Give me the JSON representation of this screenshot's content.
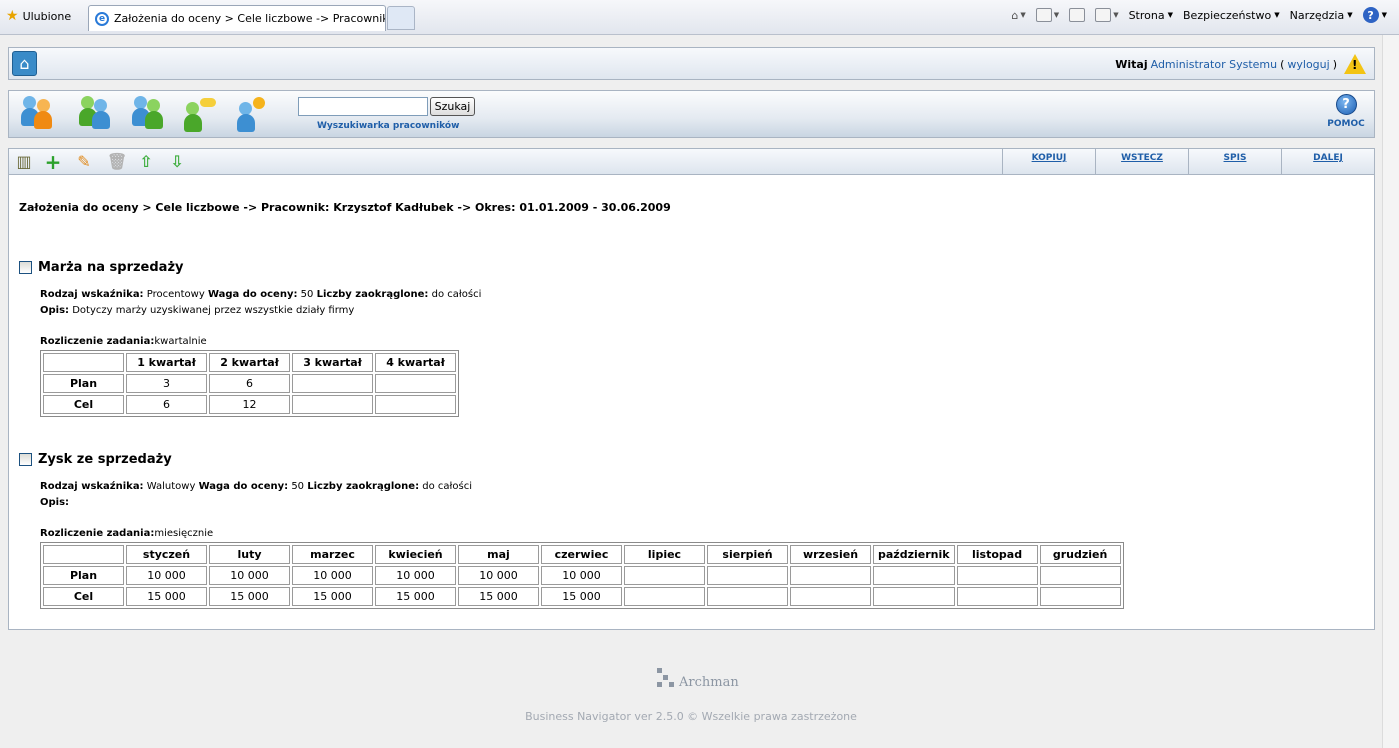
{
  "browser": {
    "favorites_label": "Ulubione",
    "tab_title": "Założenia do oceny > Cele liczbowe -> Pracownik: Krz...",
    "cmd_strona": "Strona",
    "cmd_bezpieczenstwo": "Bezpieczeństwo",
    "cmd_narzedzia": "Narzędzia"
  },
  "header": {
    "welcome_prefix": "Witaj",
    "user_name": "Administrator Systemu",
    "logout_open": "(",
    "logout_label": "wyloguj",
    "logout_close": ")"
  },
  "nav": {
    "search_value": "",
    "search_button": "Szukaj",
    "search_label": "Wyszukiwarka pracowników",
    "help_label": "POMOC"
  },
  "toolbar": {
    "links": [
      "KOPIUJ",
      "WSTECZ",
      "SPIS",
      "DALEJ"
    ]
  },
  "breadcrumb": "Założenia do oceny > Cele liczbowe -> Pracownik: Krzysztof Kadłubek -> Okres: 01.01.2009 - 30.06.2009",
  "goals": [
    {
      "title": "Marża na sprzedaży",
      "type_label": "Rodzaj wskaźnika:",
      "type_value": "Procentowy",
      "weight_label": "Waga do oceny:",
      "weight_value": "50",
      "round_label": "Liczby zaokrąglone:",
      "round_value": "do całości",
      "desc_label": "Opis:",
      "desc_value": "Dotyczy marży uzyskiwanej przez wszystkie działy firmy",
      "settle_label": "Rozliczenie zadania:",
      "settle_value": "kwartalnie",
      "columns": [
        "1 kwartał",
        "2 kwartał",
        "3 kwartał",
        "4 kwartał"
      ],
      "rows": [
        {
          "label": "Plan",
          "values": [
            "3",
            "6",
            "",
            ""
          ]
        },
        {
          "label": "Cel",
          "values": [
            "6",
            "12",
            "",
            ""
          ]
        }
      ]
    },
    {
      "title": "Zysk ze sprzedaży",
      "type_label": "Rodzaj wskaźnika:",
      "type_value": "Walutowy",
      "weight_label": "Waga do oceny:",
      "weight_value": "50",
      "round_label": "Liczby zaokrąglone:",
      "round_value": "do całości",
      "desc_label": "Opis:",
      "desc_value": "",
      "settle_label": "Rozliczenie zadania:",
      "settle_value": "miesięcznie",
      "columns": [
        "styczeń",
        "luty",
        "marzec",
        "kwiecień",
        "maj",
        "czerwiec",
        "lipiec",
        "sierpień",
        "wrzesień",
        "październik",
        "listopad",
        "grudzień"
      ],
      "rows": [
        {
          "label": "Plan",
          "values": [
            "10 000",
            "10 000",
            "10 000",
            "10 000",
            "10 000",
            "10 000",
            "",
            "",
            "",
            "",
            "",
            ""
          ]
        },
        {
          "label": "Cel",
          "values": [
            "15 000",
            "15 000",
            "15 000",
            "15 000",
            "15 000",
            "15 000",
            "",
            "",
            "",
            "",
            "",
            ""
          ]
        }
      ]
    }
  ],
  "footer": {
    "logo_text": "Archman",
    "copyright": "Business Navigator ver 2.5.0 © Wszelkie prawa zastrzeżone"
  },
  "colors": {
    "link_blue": "#1f5ea8",
    "panel_border": "#a9b4c2",
    "warning_yellow": "#f3c414"
  }
}
